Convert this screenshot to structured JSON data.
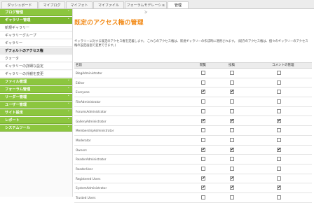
{
  "tabs": [
    "ダッシュボード",
    "マイブログ",
    "マイフォト",
    "マイファイル",
    "フォーラムモデレーション",
    "管理"
  ],
  "sidebar": [
    {
      "label": "ブログ管理",
      "type": "header"
    },
    {
      "label": "ギャラリー管理",
      "type": "header-open"
    },
    {
      "label": "新規ギャラリー",
      "type": "sub"
    },
    {
      "label": "ギャラリーグループ",
      "type": "sub"
    },
    {
      "label": "ギャラリー",
      "type": "sub"
    },
    {
      "label": "デフォルトのアクセス権",
      "type": "sub-active"
    },
    {
      "label": "クォータ",
      "type": "sub"
    },
    {
      "label": "ギャラリーの詳細な設定",
      "type": "sub"
    },
    {
      "label": "ギャラリーの外観を変更",
      "type": "sub"
    },
    {
      "label": "ファイル管理",
      "type": "header"
    },
    {
      "label": "フォーラム管理",
      "type": "header"
    },
    {
      "label": "リーダー管理",
      "type": "header"
    },
    {
      "label": "ユーザー管理",
      "type": "header"
    },
    {
      "label": "サイト設定",
      "type": "header"
    },
    {
      "label": "レポート",
      "type": "header"
    },
    {
      "label": "システムツール",
      "type": "header"
    }
  ],
  "page": {
    "title": "既定のアクセス権の管理",
    "description": "ギャラリーに対する既定のアクセス権を定義します。 これらのアクセス権は、新規ギャラリーの作成時に適用されます。 (既存のアクセス権は、個々のギャラリーのアクセス権の設定画面で変更できます。)"
  },
  "table": {
    "headers": [
      "名前",
      "閲覧",
      "投稿",
      "コメントの管理"
    ],
    "rows": [
      {
        "name": "BlogAdministrator",
        "view": false,
        "post": false,
        "manage": false
      },
      {
        "name": "Editor",
        "view": false,
        "post": false,
        "manage": false
      },
      {
        "name": "Everyone",
        "view": true,
        "post": true,
        "manage": false
      },
      {
        "name": "FileAdministrator",
        "view": false,
        "post": false,
        "manage": false
      },
      {
        "name": "ForumsAdministrator",
        "view": false,
        "post": false,
        "manage": false
      },
      {
        "name": "GalleryAdministrator",
        "view": true,
        "post": true,
        "manage": true
      },
      {
        "name": "MembershipAdministrator",
        "view": false,
        "post": false,
        "manage": false
      },
      {
        "name": "Moderator",
        "view": false,
        "post": false,
        "manage": false
      },
      {
        "name": "Owners",
        "view": true,
        "post": true,
        "manage": true
      },
      {
        "name": "ReaderAdministrator",
        "view": false,
        "post": false,
        "manage": false
      },
      {
        "name": "ReaderUser",
        "view": false,
        "post": false,
        "manage": false
      },
      {
        "name": "Registered Users",
        "view": true,
        "post": true,
        "manage": false
      },
      {
        "name": "SystemAdministrator",
        "view": true,
        "post": true,
        "manage": true
      },
      {
        "name": "Trusted Users",
        "view": false,
        "post": false,
        "manage": false
      }
    ]
  }
}
